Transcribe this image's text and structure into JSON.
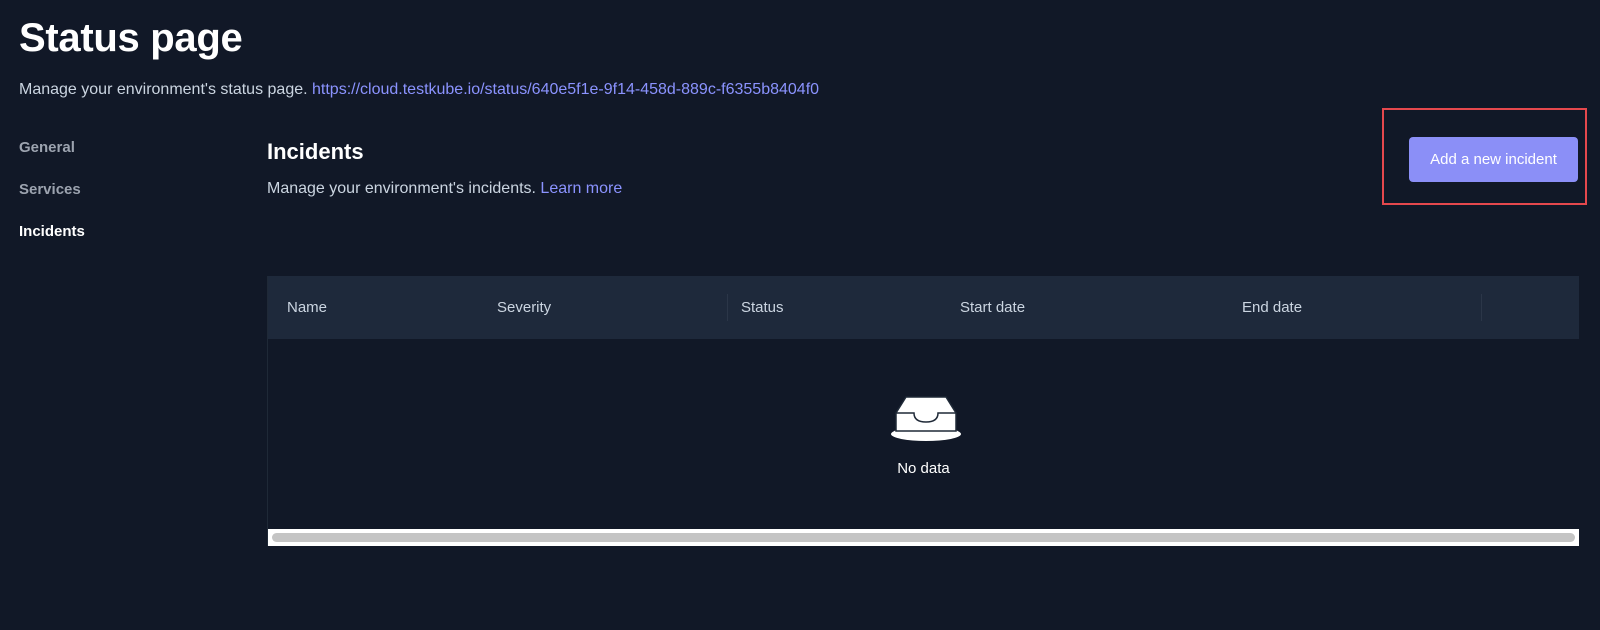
{
  "page": {
    "title": "Status page",
    "subtitle_text": "Manage your environment's status page. ",
    "status_url": "https://cloud.testkube.io/status/640e5f1e-9f14-458d-889c-f6355b8404f0"
  },
  "sidebar": {
    "items": [
      {
        "label": "General",
        "active": false
      },
      {
        "label": "Services",
        "active": false
      },
      {
        "label": "Incidents",
        "active": true
      }
    ]
  },
  "incidents": {
    "title": "Incidents",
    "description": "Manage your environment's incidents. ",
    "learn_more": "Learn more",
    "add_button": "Add a new incident",
    "columns": [
      "Name",
      "Severity",
      "Status",
      "Start date",
      "End date"
    ],
    "empty_text": "No data"
  },
  "colors": {
    "background": "#111827",
    "accent": "#8b8ff7",
    "link": "#8b93ff",
    "highlight": "#e5484d",
    "table_header": "#1e293b"
  },
  "icons": {
    "empty": "empty-inbox-icon"
  }
}
